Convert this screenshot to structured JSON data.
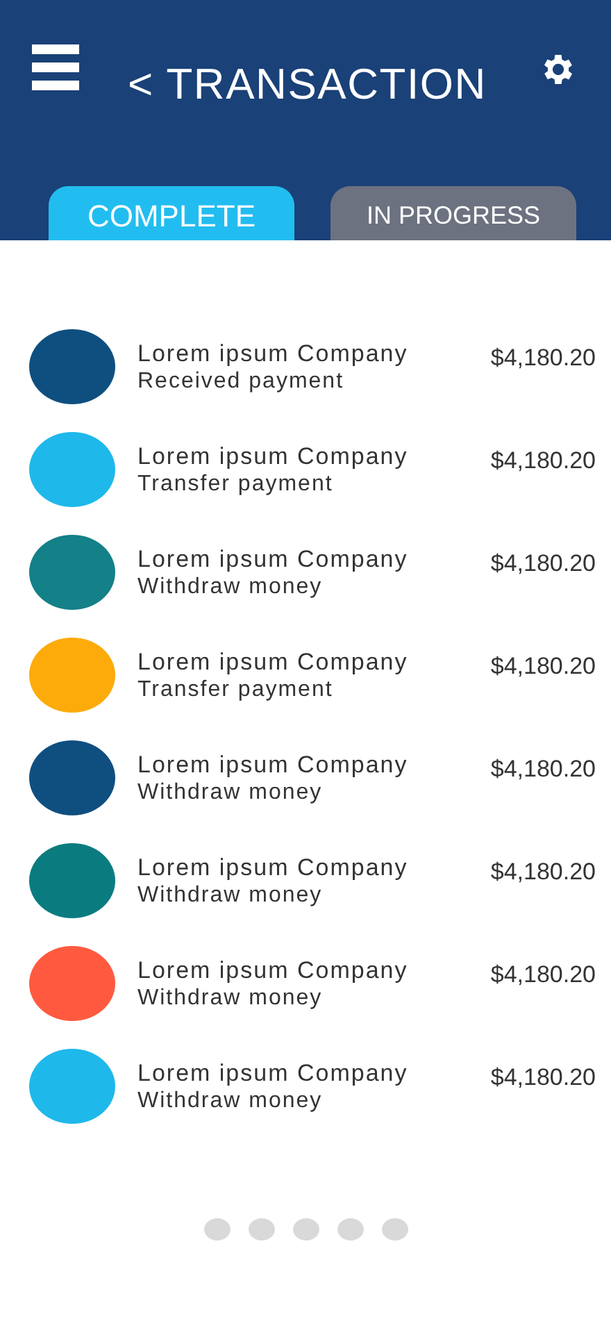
{
  "header": {
    "title": "< TRANSACTION"
  },
  "tabs": [
    {
      "label": "COMPLETE",
      "selected": true
    },
    {
      "label": "IN PROGRESS",
      "selected": false
    }
  ],
  "transactions": [
    {
      "company": "Lorem ipsum Company",
      "type": "Received payment",
      "amount": "$4,180.20",
      "color": "#0f4f80"
    },
    {
      "company": "Lorem ipsum Company",
      "type": "Transfer payment",
      "amount": "$4,180.20",
      "color": "#1fb8ea"
    },
    {
      "company": "Lorem ipsum Company",
      "type": "Withdraw money",
      "amount": "$4,180.20",
      "color": "#148087"
    },
    {
      "company": "Lorem ipsum Company",
      "type": "Transfer payment",
      "amount": "$4,180.20",
      "color": "#fdab0b"
    },
    {
      "company": "Lorem ipsum Company",
      "type": "Withdraw money",
      "amount": "$4,180.20",
      "color": "#0f4f80"
    },
    {
      "company": "Lorem ipsum Company",
      "type": "Withdraw money",
      "amount": "$4,180.20",
      "color": "#0a7c80"
    },
    {
      "company": "Lorem ipsum Company",
      "type": "Withdraw money",
      "amount": "$4,180.20",
      "color": "#ff5a3f"
    },
    {
      "company": "Lorem ipsum Company",
      "type": "Withdraw money",
      "amount": "$4,180.20",
      "color": "#1fb8ea"
    }
  ]
}
